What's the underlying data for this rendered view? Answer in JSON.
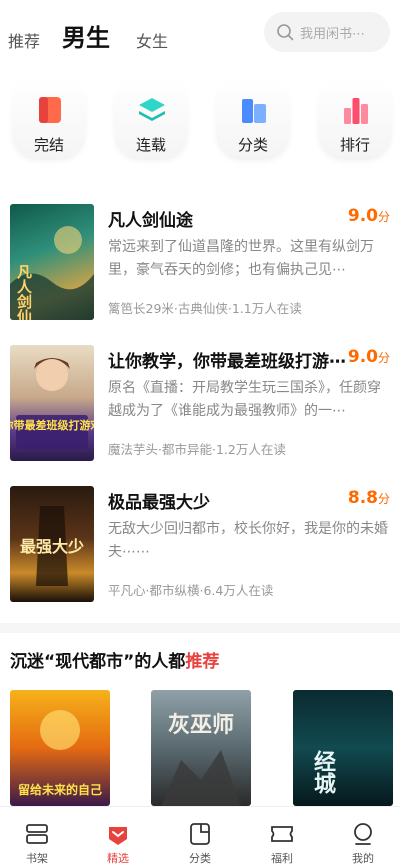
{
  "header": {
    "tabs": [
      {
        "label": "推荐"
      },
      {
        "label": "男生"
      },
      {
        "label": "女生"
      }
    ],
    "search_placeholder": "我用闲书⋯"
  },
  "categories": [
    {
      "label": "完结",
      "icon": "book-icon"
    },
    {
      "label": "连载",
      "icon": "layers-icon"
    },
    {
      "label": "分类",
      "icon": "category-icon"
    },
    {
      "label": "排行",
      "icon": "ranking-icon"
    }
  ],
  "books": [
    {
      "title": "凡人剑仙途",
      "score": "9.0",
      "score_unit": "分",
      "desc": "常远来到了仙道昌隆的世界。这里有纵剑万里，豪气吞天的剑修；也有偏执己见⋯",
      "meta": "篱笆长29米·古典仙侠·1.1万人在读",
      "cover_text": "凡人剑仙途"
    },
    {
      "title": "让你教学，你带最差班级打游⋯",
      "score": "9.0",
      "score_unit": "分",
      "desc": "原名《直播：开局教学生玩三国杀》，任颜穿越成为了《谁能成为最强教师》的一⋯",
      "meta": "魔法芋头·都市异能·1.2万人在读",
      "cover_text": "你带最差班级打游戏"
    },
    {
      "title": "极品最强大少",
      "score": "8.8",
      "score_unit": "分",
      "desc": "无敌大少回归都市，校长你好，我是你的未婚夫⋯⋯",
      "meta": "平凡心·都市纵横·6.4万人在读",
      "cover_text": "最强大少"
    }
  ],
  "section": {
    "title_prefix": "沉迷“现代都市”的人都",
    "title_accent": "推荐"
  },
  "recommendations": [
    {
      "cover_text": "留给未来的自己"
    },
    {
      "cover_text": "灰巫师"
    },
    {
      "cover_text": "经城"
    }
  ],
  "nav": [
    {
      "label": "书架",
      "icon": "bookshelf-icon"
    },
    {
      "label": "精选",
      "icon": "featured-icon"
    },
    {
      "label": "分类",
      "icon": "category-icon"
    },
    {
      "label": "福利",
      "icon": "ticket-icon"
    },
    {
      "label": "我的",
      "icon": "profile-icon"
    }
  ],
  "colors": {
    "accent": "#e8423d",
    "score": "#ff6a00"
  }
}
